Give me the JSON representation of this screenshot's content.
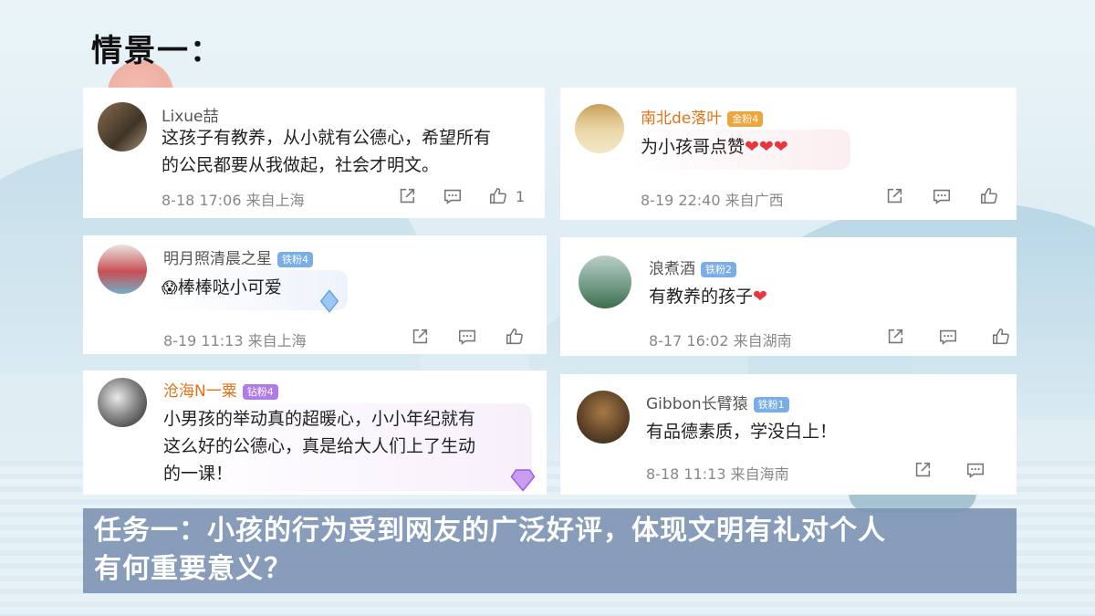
{
  "page": {
    "title": "情景一："
  },
  "comments": [
    {
      "user": "Lixue喆",
      "badge": "",
      "text": "这孩子有教养，从小就有公德心，希望所有的公民都要从我做起，社会才明文。",
      "text_lines": [
        "这孩子有教养，从小就有公德心，希望所有",
        "的公民都要从我做起，社会才明文。"
      ],
      "meta": "8-18 17:06  来自上海",
      "likes": "1"
    },
    {
      "user": "南北de落叶",
      "badge": "金粉4",
      "text": "为小孩哥点赞",
      "emoji": "❤❤❤",
      "meta": "8-19 22:40  来自广西",
      "likes": ""
    },
    {
      "user": "明月照清晨之星",
      "badge": "铁粉4",
      "text": "棒棒哒小可爱",
      "emoji_prefix": "😱",
      "meta": "8-19 11:13  来自上海",
      "likes": ""
    },
    {
      "user": "浪煮酒",
      "badge": "铁粉2",
      "text": "有教养的孩子",
      "emoji": "❤",
      "meta": "8-17 16:02  来自湖南",
      "likes": ""
    },
    {
      "user": "沧海N一粟",
      "badge": "钻粉4",
      "text": "小男孩的举动真的超暖心，小小年纪就有这么好的公德心，真是给大人们上了生动的一课！",
      "text_lines": [
        "小男孩的举动真的超暖心，小小年纪就有",
        "这么好的公德心，真是给大人们上了生动",
        "的一课！"
      ],
      "meta": "",
      "likes": ""
    },
    {
      "user": "Gibbon长臂猿",
      "badge": "铁粉1",
      "text": "有品德素质，学没白上！",
      "meta": "8-18 11:13  来自海南",
      "likes": ""
    }
  ],
  "task": {
    "line1": "任务一：小孩的行为受到网友的广泛好评，体现文明有礼对个人",
    "line2": "有何重要意义？"
  },
  "icons": [
    "share-icon",
    "comment-icon",
    "like-icon"
  ],
  "colors": {
    "orange_name": "#e0731a",
    "task_bg": "#7a91b2",
    "heart": "#e8363c"
  }
}
